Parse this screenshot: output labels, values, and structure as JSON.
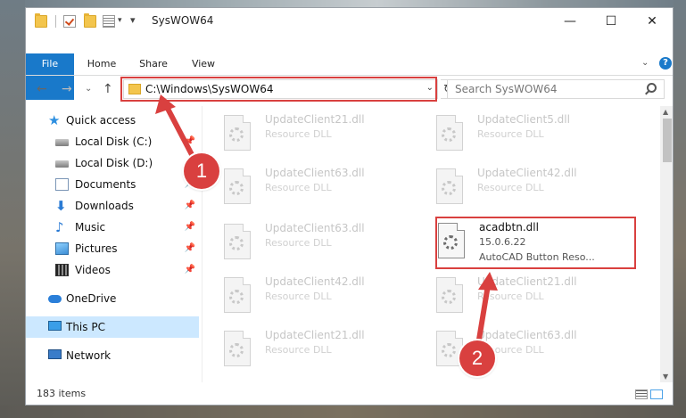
{
  "window": {
    "title": "SysWOW64",
    "minimize": "—",
    "maximize": "☐",
    "close": "✕"
  },
  "ribbon": {
    "tabs": [
      {
        "label": "File"
      },
      {
        "label": "Home"
      },
      {
        "label": "Share"
      },
      {
        "label": "View"
      }
    ],
    "expand": "⌄",
    "help": "?"
  },
  "nav": {
    "back": "←",
    "forward": "→",
    "recent": "⌄",
    "up": "↑"
  },
  "address": {
    "path": "C:\\Windows\\SysWOW64",
    "dropdown": "⌄",
    "refresh": "↻"
  },
  "search": {
    "placeholder": "Search SysWOW64"
  },
  "sidebar": {
    "items": [
      {
        "label": "Quick access",
        "icon": "star-icon"
      },
      {
        "label": "Local Disk (C:)",
        "icon": "disk-icon",
        "pin": "📌"
      },
      {
        "label": "Local Disk (D:)",
        "icon": "disk-icon"
      },
      {
        "label": "Documents",
        "icon": "documents-icon",
        "pin": "📌"
      },
      {
        "label": "Downloads",
        "icon": "downloads-icon",
        "pin": "📌"
      },
      {
        "label": "Music",
        "icon": "music-icon",
        "pin": "📌"
      },
      {
        "label": "Pictures",
        "icon": "pictures-icon",
        "pin": "📌"
      },
      {
        "label": "Videos",
        "icon": "videos-icon",
        "pin": "📌"
      },
      {
        "label": "OneDrive",
        "icon": "cloud-icon"
      },
      {
        "label": "This PC",
        "icon": "computer-icon"
      },
      {
        "label": "Network",
        "icon": "network-icon"
      }
    ]
  },
  "files": [
    {
      "name": "UpdateClient21.dll",
      "type": "Resource DLL"
    },
    {
      "name": "UpdateClient5.dll",
      "type": "Resource DLL"
    },
    {
      "name": "UpdateClient63.dll",
      "type": "Resource DLL"
    },
    {
      "name": "UpdateClient42.dll",
      "type": "Resource DLL"
    },
    {
      "name": "UpdateClient63.dll",
      "type": "Resource DLL"
    },
    {
      "name": "acadbtn.dll",
      "type": "15.0.6.22",
      "description": "AutoCAD Button Reso..."
    },
    {
      "name": "UpdateClient42.dll",
      "type": "Resource DLL"
    },
    {
      "name": "UpdateClient21.dll",
      "type": "Resource DLL"
    },
    {
      "name": "UpdateClient21.dll",
      "type": "Resource DLL"
    },
    {
      "name": "UpdateClient63.dll",
      "type": "Resource DLL"
    }
  ],
  "status": {
    "count": "183 items"
  },
  "callouts": {
    "one": "1",
    "two": "2"
  },
  "colors": {
    "accent": "#1979ca",
    "highlight": "#d9403f",
    "selected": "#cce8ff"
  }
}
